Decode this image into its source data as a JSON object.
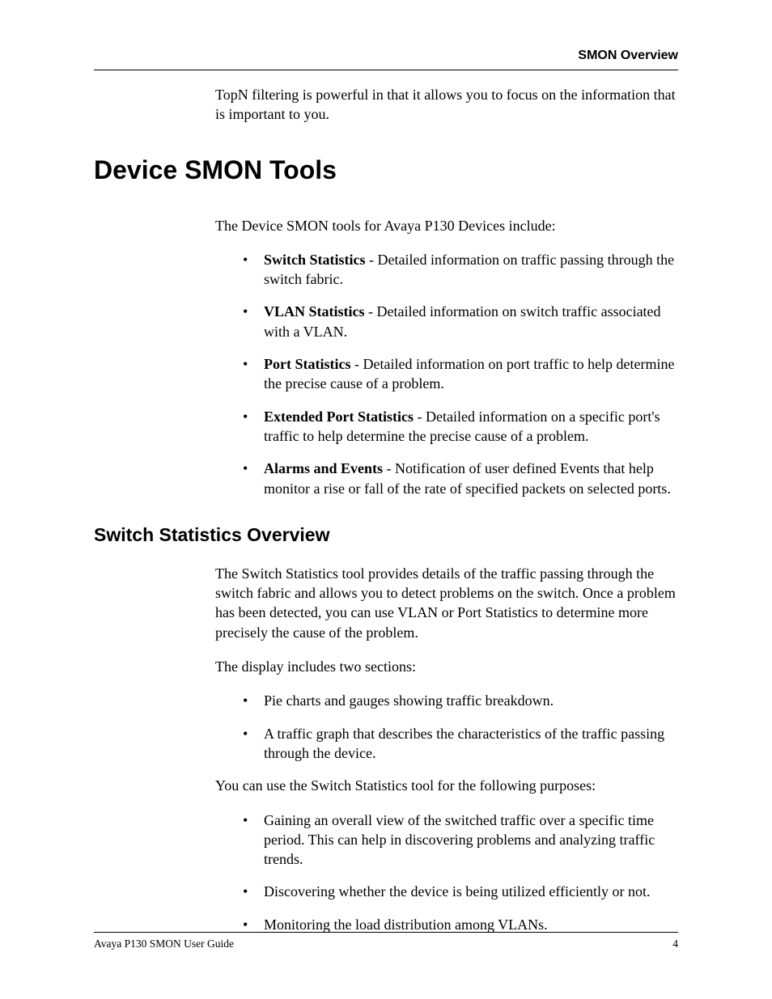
{
  "header": {
    "title": "SMON Overview"
  },
  "intro": "TopN filtering is powerful in that it allows you to focus on the information that is important to you.",
  "section": {
    "title": "Device SMON Tools",
    "lead": "The Device SMON tools for Avaya P130 Devices include:",
    "items": [
      {
        "term": "Switch Statistics",
        "desc": " - Detailed information on traffic passing through the switch fabric."
      },
      {
        "term": "VLAN Statistics",
        "desc": " - Detailed information on switch traffic associated with a VLAN."
      },
      {
        "term": "Port Statistics",
        "desc": " - Detailed information on port traffic to help determine the precise cause of a problem."
      },
      {
        "term": "Extended Port Statistics",
        "desc": " - Detailed information on a specific port's traffic to help determine the precise cause of a problem."
      },
      {
        "term": "Alarms and Events",
        "desc": " - Notification of user defined Events that help monitor a rise or fall of the rate of specified packets on selected ports."
      }
    ]
  },
  "subsection": {
    "title": "Switch Statistics Overview",
    "p1": "The Switch Statistics tool provides details of the traffic passing through the switch fabric and allows you to detect problems on the switch. Once a problem has been detected, you can use VLAN or Port Statistics to determine more precisely the cause of the problem.",
    "p2": "The display includes two sections:",
    "list1": [
      "Pie charts and gauges showing traffic breakdown.",
      "A traffic graph that describes the characteristics of the traffic passing through the device."
    ],
    "p3": "You can use the Switch Statistics tool for the following purposes:",
    "list2": [
      "Gaining an overall view of the switched traffic over a specific time period. This can help in discovering problems and analyzing traffic trends.",
      "Discovering whether the device is being utilized efficiently or not.",
      "Monitoring the load distribution among VLANs."
    ]
  },
  "footer": {
    "left": "Avaya P130 SMON User Guide",
    "right": "4"
  }
}
